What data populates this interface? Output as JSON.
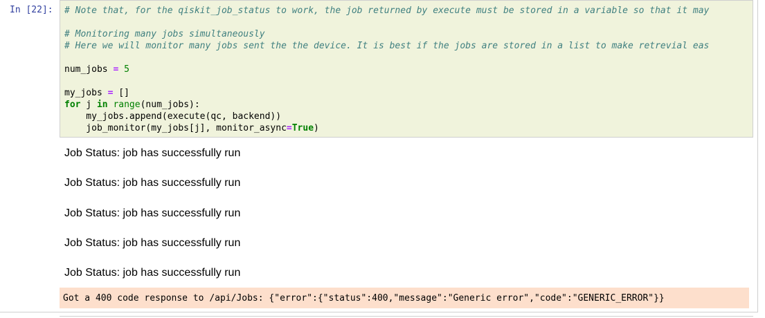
{
  "cell": {
    "prompt": "In [22]:",
    "code_lines": [
      {
        "parts": [
          {
            "t": "# Note that, for the qiskit_job_status to work, the job returned by execute must be stored in a variable so that it may",
            "c": "cm"
          }
        ]
      },
      {
        "parts": []
      },
      {
        "parts": [
          {
            "t": "# Monitoring many jobs simultaneously",
            "c": "cm"
          }
        ]
      },
      {
        "parts": [
          {
            "t": "# Here we will monitor many jobs sent the the device. It is best if the jobs are stored in a list to make retrevial eas",
            "c": "cm"
          }
        ]
      },
      {
        "parts": []
      },
      {
        "parts": [
          {
            "t": "num_jobs ",
            "c": ""
          },
          {
            "t": "=",
            "c": "op"
          },
          {
            "t": " ",
            "c": ""
          },
          {
            "t": "5",
            "c": "num"
          }
        ]
      },
      {
        "parts": []
      },
      {
        "parts": [
          {
            "t": "my_jobs ",
            "c": ""
          },
          {
            "t": "=",
            "c": "op"
          },
          {
            "t": " []",
            "c": ""
          }
        ]
      },
      {
        "parts": [
          {
            "t": "for",
            "c": "kw"
          },
          {
            "t": " j ",
            "c": ""
          },
          {
            "t": "in",
            "c": "kw"
          },
          {
            "t": " ",
            "c": ""
          },
          {
            "t": "range",
            "c": "bi"
          },
          {
            "t": "(num_jobs):",
            "c": ""
          }
        ]
      },
      {
        "parts": [
          {
            "t": "    my_jobs.append(execute(qc, backend))",
            "c": ""
          }
        ]
      },
      {
        "parts": [
          {
            "t": "    job_monitor(my_jobs[j], monitor_async",
            "c": ""
          },
          {
            "t": "=",
            "c": "op"
          },
          {
            "t": "True",
            "c": "kw"
          },
          {
            "t": ")",
            "c": ""
          }
        ]
      }
    ]
  },
  "output": {
    "status_lines": [
      "Job Status: job has successfully run",
      "Job Status: job has successfully run",
      "Job Status: job has successfully run",
      "Job Status: job has successfully run",
      "Job Status: job has successfully run"
    ],
    "error": "Got a 400 code response to /api/Jobs: {\"error\":{\"status\":400,\"message\":\"Generic error\",\"code\":\"GENERIC_ERROR\"}}"
  },
  "colors": {
    "input_bg": "#f0f3dc",
    "error_bg": "#fddfcc",
    "prompt": "#303f9f",
    "comment": "#408080",
    "keyword": "#008000",
    "operator": "#aa22ff"
  }
}
